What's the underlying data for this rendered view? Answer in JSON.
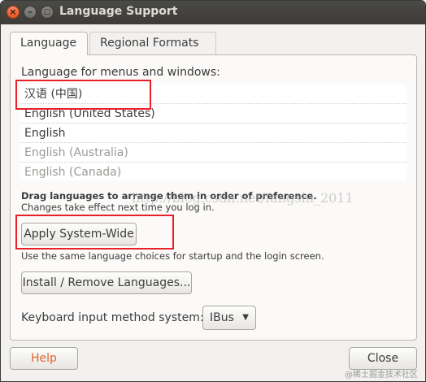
{
  "window": {
    "title": "Language Support"
  },
  "tabs": [
    {
      "label": "Language"
    },
    {
      "label": "Regional Formats"
    }
  ],
  "language": {
    "section_label": "Language for menus and windows:",
    "items": [
      {
        "label": "汉语 (中国)"
      },
      {
        "label": "English (United States)"
      },
      {
        "label": "English"
      },
      {
        "label": "English (Australia)"
      },
      {
        "label": "English (Canada)"
      }
    ],
    "drag_hint": "Drag languages to arrange them in order of preference.",
    "changes_hint": "Changes take effect next time you log in.",
    "apply_label": "Apply System-Wide",
    "same_hint": "Use the same language choices for startup and the login screen.",
    "install_label": "Install / Remove Languages...",
    "keyboard_label": "Keyboard input method system:",
    "keyboard_value": "IBus"
  },
  "footer": {
    "help_label": "Help",
    "close_label": "Close"
  },
  "overlay": {
    "watermark": "http://blog.csdn.net/fangshi_2011",
    "corner_watermark": "@稀土掘金技术社区"
  },
  "colors": {
    "highlight": "#e8202a",
    "help_text": "#e0622a",
    "titlebar": "#3c3b37"
  }
}
